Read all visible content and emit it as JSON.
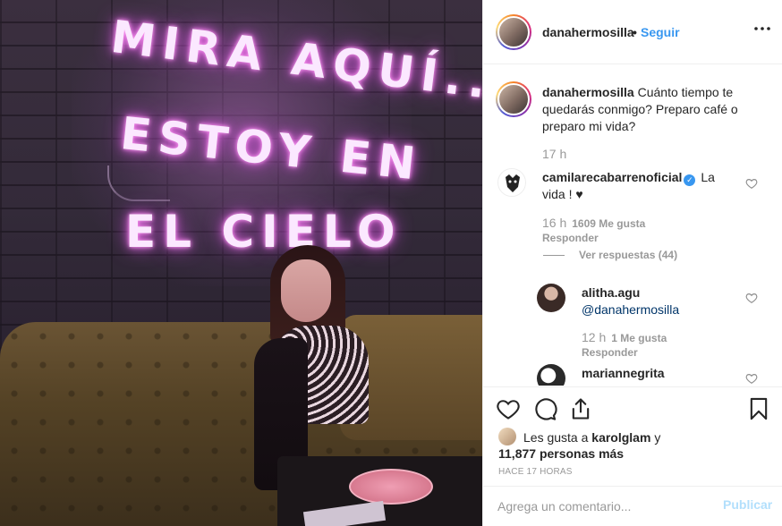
{
  "photo": {
    "neon_lines": [
      "MIRA AQUÍ...",
      "ESTOY EN",
      "EL CIELO"
    ]
  },
  "header": {
    "username": "danahermosilla",
    "separator": "•",
    "follow_label": "Seguir",
    "more_icon": "more-options-icon"
  },
  "caption": {
    "username": "danahermosilla",
    "text": "Cuánto tiempo te quedarás conmigo? Preparo café o preparo mi vida?",
    "time": "17 h"
  },
  "comments": [
    {
      "username": "camilarecabarrenoficial",
      "verified": true,
      "text": "La vida ! ♥",
      "time": "16 h",
      "likes": "1609 Me gusta",
      "reply_label": "Responder",
      "see_replies": "Ver respuestas (44)"
    },
    {
      "username": "alitha.agu",
      "text": "@danahermosilla",
      "time": "12 h",
      "likes": "1 Me gusta",
      "reply_label": "Responder"
    },
    {
      "username": "mariannegrita"
    }
  ],
  "actions": {
    "likes_prefix": "Les gusta a",
    "likes_user": "karolglam",
    "likes_and": "y",
    "likes_count": "11,877 personas más",
    "when": "HACE 17 HORAS"
  },
  "add_comment": {
    "placeholder": "Agrega un comentario...",
    "publish_label": "Publicar"
  },
  "colors": {
    "accent": "#3897f0",
    "publish_disabled": "#b2dffc",
    "muted": "#999999"
  }
}
